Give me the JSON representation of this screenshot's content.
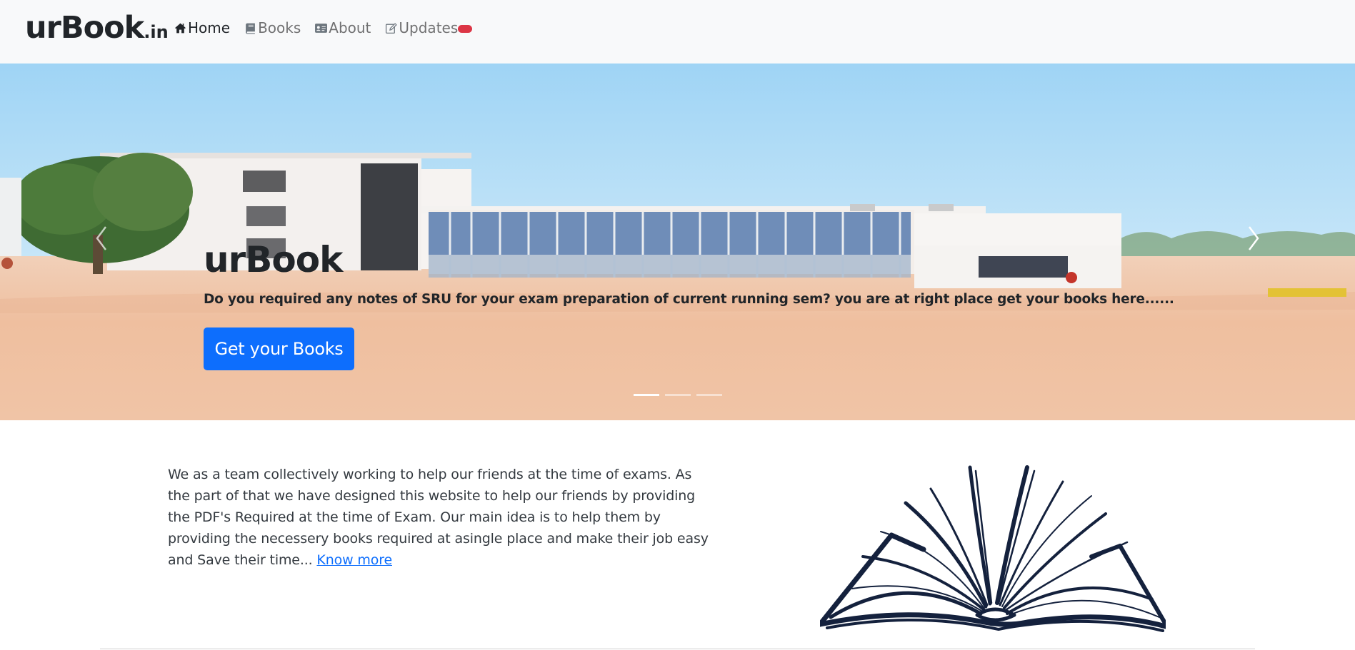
{
  "brand": {
    "name": "urBook",
    "tld": ".in"
  },
  "nav": {
    "items": [
      {
        "label": "Home",
        "icon": "home-icon",
        "active": true
      },
      {
        "label": "Books",
        "icon": "book-icon",
        "active": false
      },
      {
        "label": "About",
        "icon": "id-card-icon",
        "active": false
      },
      {
        "label": "Updates",
        "icon": "edit-icon",
        "active": false
      }
    ]
  },
  "hero": {
    "title": "urBook",
    "text": "Do you required any notes of SRU for your exam preparation of current running sem? you are at right place get your books here......",
    "button_label": "Get your Books",
    "slides": 3,
    "active_slide": 1
  },
  "about": {
    "text": "We as a team collectively working to help our friends at the time of exams. As the part of that we have designed this website to help our friends by providing the PDF's Required at the time of Exam. Our main idea is to help them by providing the necessery books required at asingle place and make their job easy and Save their time...",
    "link_label": "Know more"
  },
  "colors": {
    "primary": "#0d6efd",
    "badge": "#dc3545",
    "navbar_bg": "#f8f9fa",
    "book_ink": "#14213d"
  }
}
